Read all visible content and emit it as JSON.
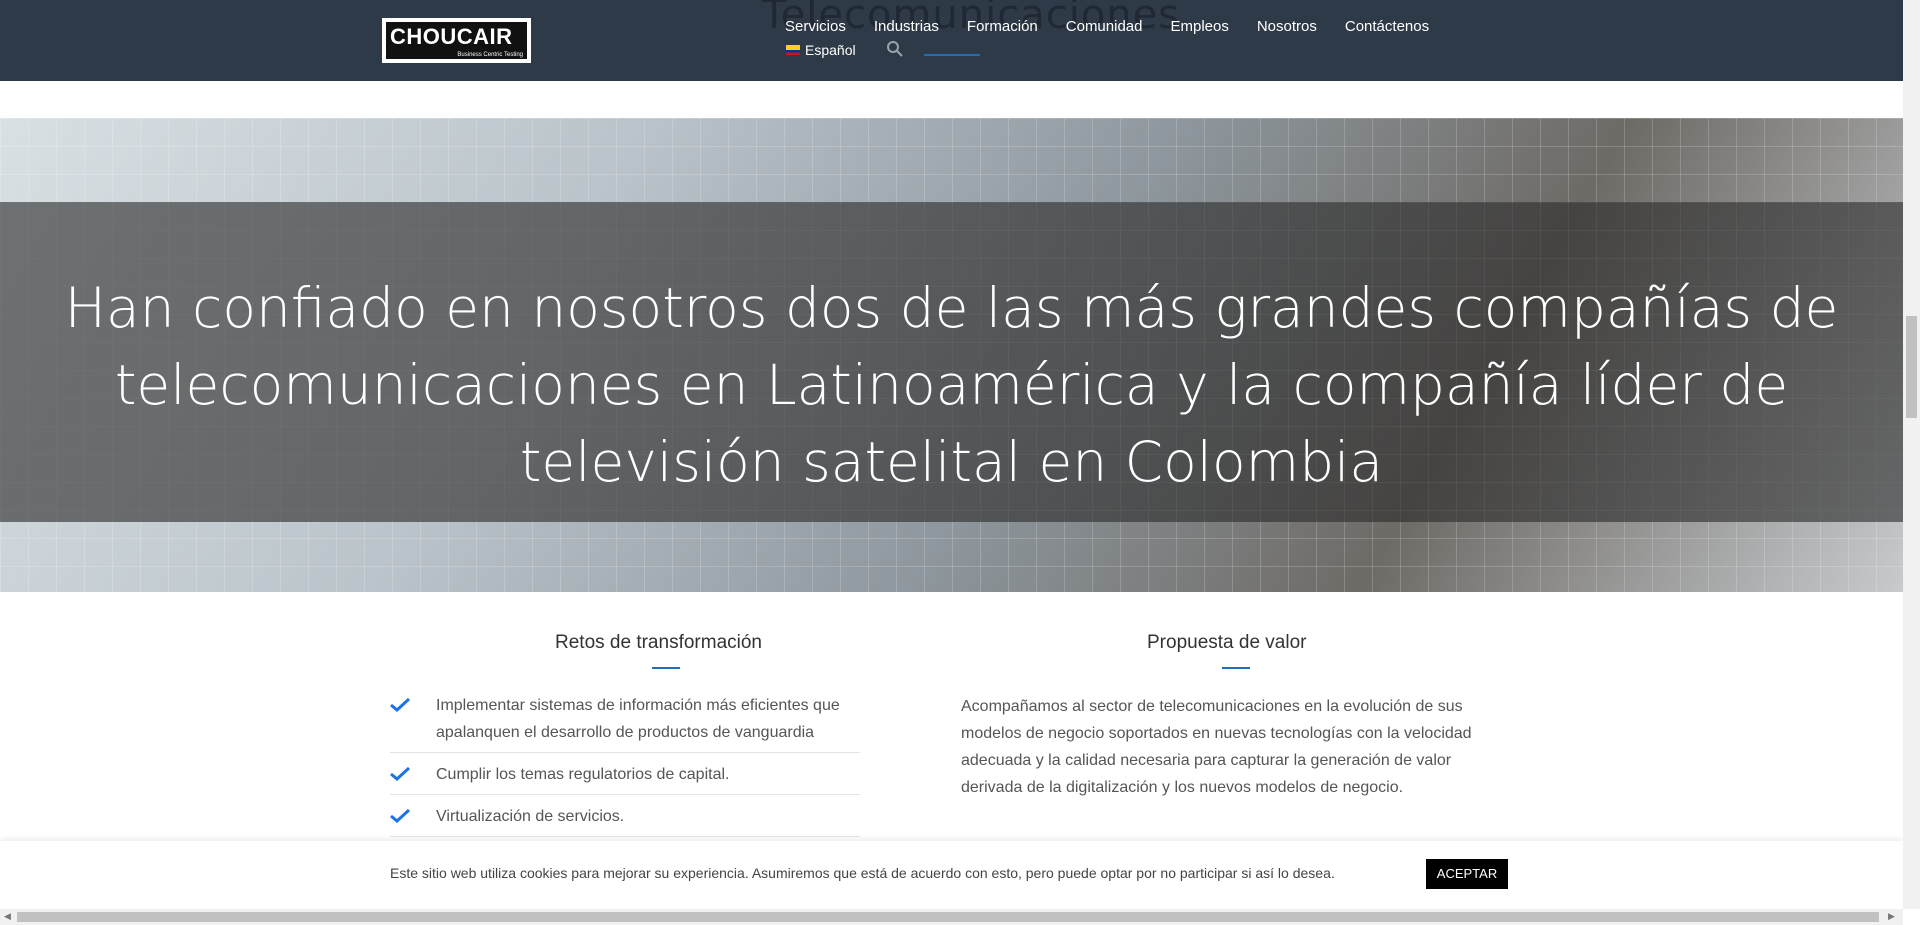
{
  "header": {
    "ghost_title": "Telecomunicaciones",
    "logo_text": "CHOUCAIR",
    "logo_sub": "Business Centric Testing",
    "nav": [
      "Servicios",
      "Industrias",
      "Formación",
      "Comunidad",
      "Empleos",
      "Nosotros",
      "Contáctenos"
    ],
    "language": "Español"
  },
  "hero": {
    "line1": "Han confiado en nosotros dos de las más grandes compañías de",
    "line2": "telecomunicaciones en Latinoamérica y la compañía líder de",
    "line3": "televisión satelital en Colombia"
  },
  "retos": {
    "title": "Retos de transformación",
    "items": [
      "Implementar sistemas de información más eficientes que apalanquen el desarrollo de productos de vanguardia",
      "Cumplir los temas regulatorios de capital.",
      "Virtualización de servicios."
    ]
  },
  "propuesta": {
    "title": "Propuesta de valor",
    "text": "Acompañamos al sector de telecomunicaciones en la evolución de sus modelos de negocio soportados en nuevas tecnologías con la velocidad adecuada y la calidad necesaria para capturar la generación de valor derivada de la digitalización y los nuevos modelos de negocio."
  },
  "cookie": {
    "text": "Este sitio web utiliza cookies para mejorar su experiencia. Asumiremos que está de acuerdo con esto, pero puede optar por no participar si así lo desea.",
    "button": "ACEPTAR"
  },
  "colors": {
    "header_bg": "#2f3a48",
    "accent": "#1e6fb8",
    "check": "#1a73e8"
  }
}
